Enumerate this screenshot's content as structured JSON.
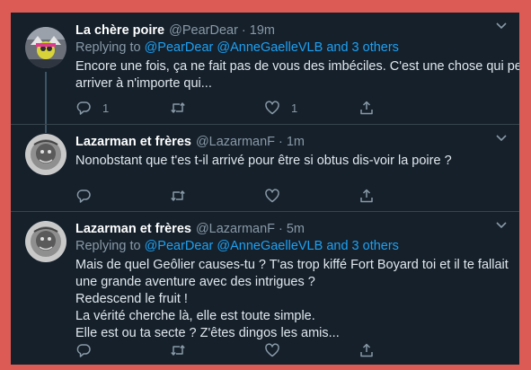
{
  "tweets": [
    {
      "name": "La chère poire",
      "handle": "@PearDear",
      "separator": "·",
      "time": "19m",
      "replying_prefix": "Replying to ",
      "replying_links": "@PearDear @AnneGaelleVLB and 3 others",
      "lines": [
        "Encore une fois, ça ne fait pas de vous des imbéciles. C'est une chose qui peut",
        "arriver à n'importe qui..."
      ],
      "reply_count": "1",
      "retweet_count": "",
      "like_count": "1"
    },
    {
      "name": "Lazarman et frères",
      "handle": "@LazarmanF",
      "separator": "·",
      "time": "1m",
      "lines": [
        "Nonobstant que t'es t-il arrivé pour être si obtus dis-voir la poire ?"
      ],
      "reply_count": "",
      "retweet_count": "",
      "like_count": ""
    },
    {
      "name": "Lazarman et frères",
      "handle": "@LazarmanF",
      "separator": "·",
      "time": "5m",
      "replying_prefix": "Replying to ",
      "replying_links": "@PearDear @AnneGaelleVLB and 3 others",
      "lines": [
        "Mais de quel Geôlier causes-tu ? T'as trop kiffé Fort Boyard toi et il te fallait",
        "une grande aventure avec des intrigues ?",
        "Redescend le fruit !",
        "La vérité cherche là, elle est toute simple.",
        "Elle est ou ta secte ? Z'êtes dingos les amis..."
      ],
      "reply_count": "",
      "retweet_count": "",
      "like_count": ""
    }
  ],
  "colors": {
    "background_border": "#dc5b55",
    "panel": "#15202b",
    "link": "#1da1f2",
    "muted": "#8899a6"
  },
  "icons": [
    "reply-icon",
    "retweet-icon",
    "like-icon",
    "share-icon",
    "chevron-down-icon"
  ]
}
